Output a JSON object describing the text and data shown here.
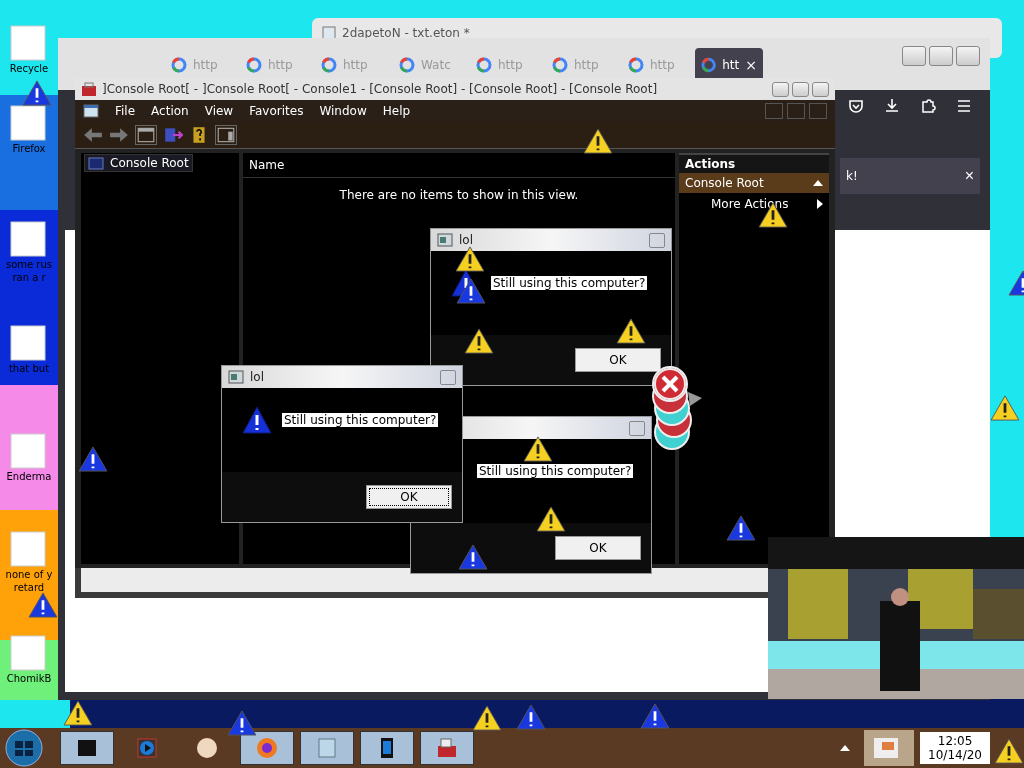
{
  "desktop_icons": [
    {
      "lines": [
        "Recycle"
      ]
    },
    {
      "lines": [
        "Firefox"
      ]
    },
    {
      "lines": [
        "some rus",
        "ran a r"
      ]
    },
    {
      "lines": [
        "that but"
      ]
    },
    {
      "lines": [
        "Enderma"
      ]
    },
    {
      "lines": [
        "none of y",
        "retard"
      ]
    },
    {
      "lines": [
        "ChomikB"
      ]
    }
  ],
  "notepad": {
    "title": "2dapetoN - txt.eton *"
  },
  "browser": {
    "tabs": [
      {
        "label": "http",
        "selected": false
      },
      {
        "label": "http",
        "selected": false
      },
      {
        "label": "http",
        "selected": false
      },
      {
        "label": "Watc",
        "selected": false
      },
      {
        "label": "http",
        "selected": false
      },
      {
        "label": "http",
        "selected": false
      },
      {
        "label": "http",
        "selected": false
      },
      {
        "label": "htt",
        "selected": true
      }
    ],
    "tab_close": "×",
    "notification": "k!",
    "notification_close": "×"
  },
  "console": {
    "title": "]Console Root[ - ]Console Root[ - Console1 - [Console Root] - [Console Root] - [Console Root]",
    "menu": [
      "File",
      "Action",
      "View",
      "Favorites",
      "Window",
      "Help"
    ],
    "tree": [
      {
        "label": "Console Root",
        "selected": true
      }
    ],
    "list_column": "Name",
    "empty_message": "There are no items to show in this view.",
    "actions": {
      "title": "Actions",
      "section": "Console Root",
      "items": [
        "More Actions"
      ]
    }
  },
  "dialogs": [
    {
      "kind": "full",
      "title": "lol",
      "message": "Still using this computer?",
      "button": "OK",
      "focused": false
    },
    {
      "kind": "full",
      "title": "lol",
      "message": "Still using this computer?",
      "button": "OK",
      "focused": true
    },
    {
      "kind": "covered",
      "message": "Still using this computer?",
      "button": "OK",
      "focused": false
    }
  ],
  "taskbar": {
    "clock": {
      "time": "12:05",
      "date": "10/14/20"
    }
  }
}
